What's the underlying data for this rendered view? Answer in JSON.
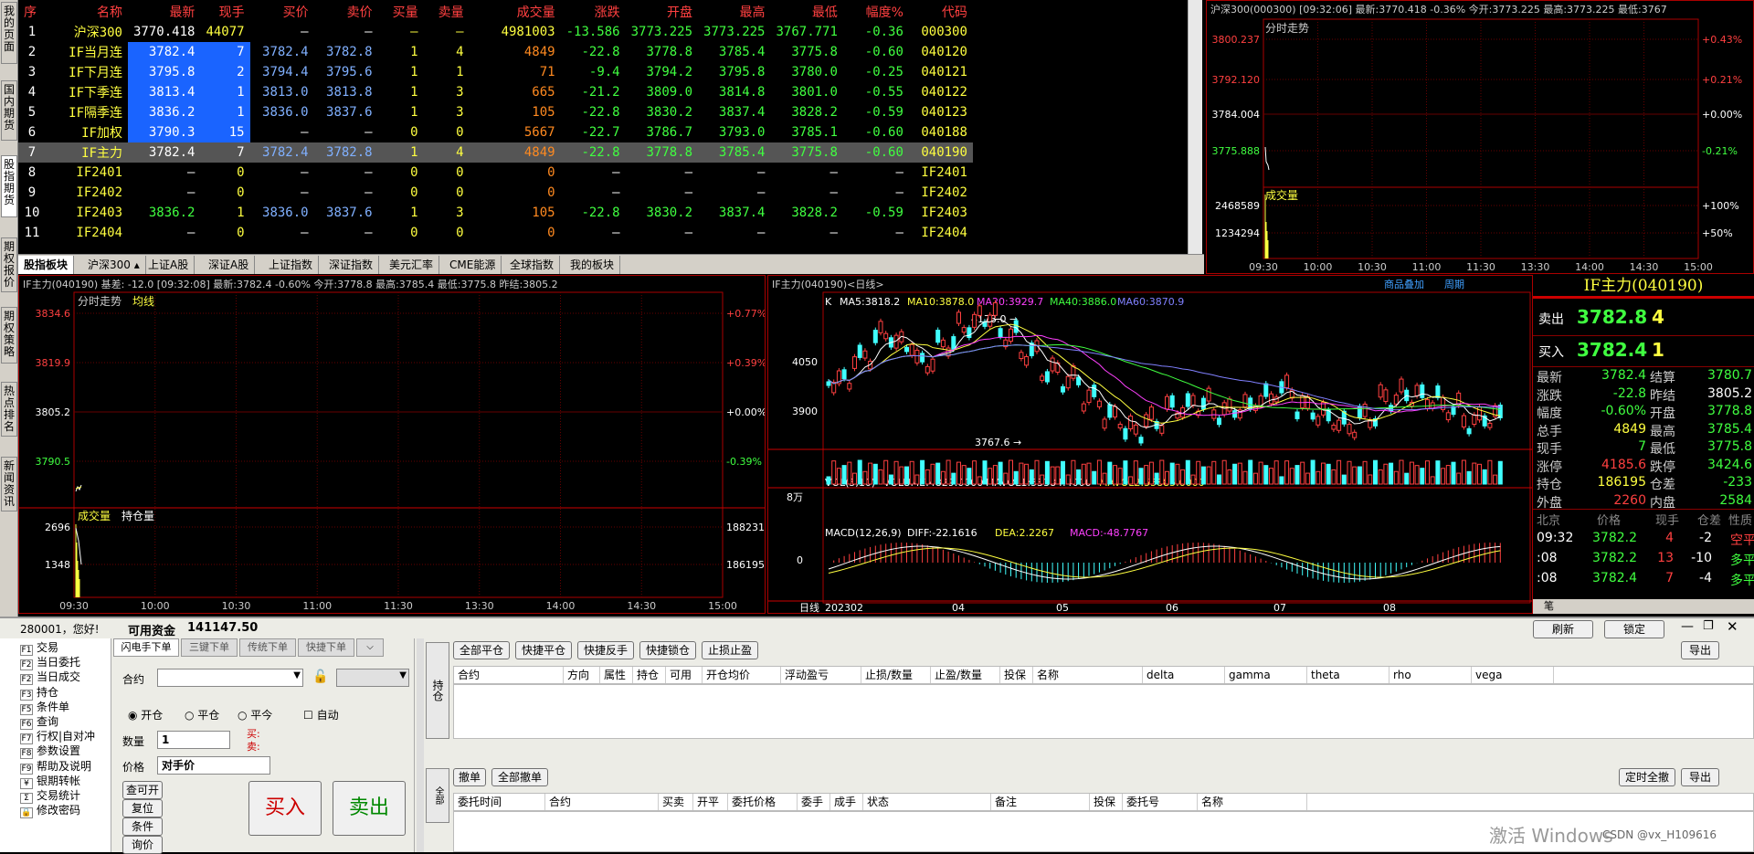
{
  "side_tabs": [
    "我的页面",
    "国内期货",
    "股指期货",
    "期权报价",
    "期权策略",
    "热点排名",
    "新闻资讯"
  ],
  "quote_table": {
    "headers": [
      "序",
      "名称",
      "最新",
      "现手",
      "买价",
      "卖价",
      "买量",
      "卖量",
      "成交量",
      "涨跌",
      "开盘",
      "最高",
      "最低",
      "幅度%",
      "代码"
    ],
    "rows": [
      [
        "1",
        "沪深300",
        "3770.418",
        "44077",
        "—",
        "—",
        "—",
        "—",
        "4981003",
        "-13.586",
        "3773.225",
        "3773.225",
        "3767.771",
        "-0.36",
        "000300"
      ],
      [
        "2",
        "IF当月连",
        "3782.4",
        "7",
        "3782.4",
        "3782.8",
        "1",
        "4",
        "4849",
        "-22.8",
        "3778.8",
        "3785.4",
        "3775.8",
        "-0.60",
        "040120"
      ],
      [
        "3",
        "IF下月连",
        "3795.8",
        "2",
        "3794.4",
        "3795.6",
        "1",
        "1",
        "71",
        "-9.4",
        "3794.2",
        "3795.8",
        "3780.0",
        "-0.25",
        "040121"
      ],
      [
        "4",
        "IF下季连",
        "3813.4",
        "1",
        "3813.0",
        "3813.8",
        "1",
        "3",
        "665",
        "-21.2",
        "3809.0",
        "3814.8",
        "3801.0",
        "-0.55",
        "040122"
      ],
      [
        "5",
        "IF隔季连",
        "3836.2",
        "1",
        "3836.0",
        "3837.6",
        "1",
        "3",
        "105",
        "-22.8",
        "3830.2",
        "3837.4",
        "3828.2",
        "-0.59",
        "040123"
      ],
      [
        "6",
        "IF加权",
        "3790.3",
        "15",
        "—",
        "—",
        "0",
        "0",
        "5667",
        "-22.7",
        "3786.7",
        "3793.0",
        "3785.1",
        "-0.60",
        "040188"
      ],
      [
        "7",
        "IF主力",
        "3782.4",
        "7",
        "3782.4",
        "3782.8",
        "1",
        "4",
        "4849",
        "-22.8",
        "3778.8",
        "3785.4",
        "3775.8",
        "-0.60",
        "040190"
      ],
      [
        "8",
        "IF2401",
        "—",
        "0",
        "—",
        "—",
        "0",
        "0",
        "0",
        "—",
        "—",
        "—",
        "—",
        "—",
        "IF2401"
      ],
      [
        "9",
        "IF2402",
        "—",
        "0",
        "—",
        "—",
        "0",
        "0",
        "0",
        "—",
        "—",
        "—",
        "—",
        "—",
        "IF2402"
      ],
      [
        "10",
        "IF2403",
        "3836.2",
        "1",
        "3836.0",
        "3837.6",
        "1",
        "3",
        "105",
        "-22.8",
        "3830.2",
        "3837.4",
        "3828.2",
        "-0.59",
        "IF2403"
      ],
      [
        "11",
        "IF2404",
        "—",
        "0",
        "—",
        "—",
        "0",
        "0",
        "0",
        "—",
        "—",
        "—",
        "—",
        "—",
        "IF2404"
      ]
    ]
  },
  "bottom_tabs": [
    "股指板块",
    "沪深300 ▴",
    "上证A股",
    "深证A股",
    "上证指数",
    "深证指数",
    "美元汇率",
    "CME能源",
    "全球指数",
    "我的板块"
  ],
  "right_top": {
    "header": "沪深300(000300)  [09:32:06] 最新:3770.418 -0.36% 今开:3773.225 最高:3773.225 最低:3767",
    "title": "分时走势",
    "vol_title": "成交量",
    "prices": [
      "3800.237",
      "3792.120",
      "3784.004",
      "3775.888"
    ],
    "pcts": [
      "+0.43%",
      "+0.21%",
      "+0.00%",
      "-0.21%"
    ],
    "vol_ticks": [
      "2468589",
      "1234294"
    ],
    "vol_pcts": [
      "+100%",
      "+50%"
    ],
    "times": [
      "09:30",
      "10:00",
      "10:30",
      "11:00",
      "11:30",
      "13:30",
      "14:00",
      "14:30",
      "15:00"
    ]
  },
  "left_chart": {
    "header": "IF主力(040190)  基差: -12.0 [09:32:08] 最新:3782.4 -0.60% 今开:3778.8 最高:3785.4 最低:3775.8 昨结:3805.2",
    "title": "分时走势",
    "avg": "均线",
    "vol_title": "成交量",
    "oi_title": "持仓量",
    "prices": [
      "3834.6",
      "3819.9",
      "3805.2",
      "3790.5"
    ],
    "pcts": [
      "+0.77%",
      "+0.39%",
      "+0.00%",
      "-0.39%"
    ],
    "vol_ticks": [
      "2696",
      "1348"
    ],
    "oi_ticks": [
      "188231",
      "186195"
    ],
    "times": [
      "09:30",
      "10:00",
      "10:30",
      "11:00",
      "11:30",
      "13:30",
      "14:00",
      "14:30",
      "15:00"
    ]
  },
  "k_chart": {
    "header": "IF主力(040190)<日线>",
    "link1": "商品叠加",
    "link2": "周期",
    "ma": {
      "label": "K",
      "ma5": "MA5:3818.2",
      "ma10": "MA10:3878.0",
      "ma20": "MA20:3929.7",
      "ma40": "MA40:3886.0",
      "ma60": "MA60:3870.9"
    },
    "high_mark": "4173.0",
    "low_mark": "3767.6",
    "y_ticks": [
      "4050",
      "3900"
    ],
    "vol": {
      "label": "VOL(5,10)",
      "volume": "VOLUME:4829.0000",
      "mavol1": "MAVOL1:53384.4000",
      "mavol2": "MAVOL2:55885.6000",
      "tick": "8万"
    },
    "macd": {
      "label": "MACD(12,26,9)",
      "diff": "DIFF:-22.1616",
      "dea": "DEA:2.2267",
      "macd": "MACD:-48.7767",
      "tick": "0"
    },
    "x_label": "日线",
    "dates": [
      "202302",
      "04",
      "05",
      "06",
      "07",
      "08"
    ]
  },
  "info": {
    "title": "IF主力(040190)",
    "sell_label": "卖出",
    "sell_price": "3782.8",
    "sell_vol": "4",
    "buy_label": "买入",
    "buy_price": "3782.4",
    "buy_vol": "1",
    "rows": [
      [
        "最新",
        "3782.4",
        "结算",
        "3780.7"
      ],
      [
        "涨跌",
        "-22.8",
        "昨结",
        "3805.2"
      ],
      [
        "幅度",
        "-0.60%",
        "开盘",
        "3778.8"
      ],
      [
        "总手",
        "4849",
        "最高",
        "3785.4"
      ],
      [
        "现手",
        "7",
        "最低",
        "3775.8"
      ],
      [
        "涨停",
        "4185.6",
        "跌停",
        "3424.6"
      ],
      [
        "持仓",
        "186195",
        "仓差",
        "-233"
      ],
      [
        "外盘",
        "2260",
        "内盘",
        "2584"
      ]
    ],
    "tick_headers": [
      "北京",
      "价格",
      "现手",
      "仓差",
      "性质"
    ],
    "ticks": [
      [
        "09:32",
        "3782.2",
        "4",
        "-2",
        "空平"
      ],
      [
        ":08",
        "3782.2",
        "13",
        "-10",
        "多平"
      ],
      [
        ":08",
        "3782.4",
        "7",
        "-4",
        "多平"
      ]
    ],
    "footer": "笔"
  },
  "account": {
    "greeting": "280001，您好!",
    "funds_label": "可用资金",
    "funds": "141147.50",
    "refresh": "刷新",
    "lock": "锁定"
  },
  "menu": [
    [
      "F1",
      "交易"
    ],
    [
      "F2",
      "当日委托"
    ],
    [
      "F2",
      "当日成交"
    ],
    [
      "F3",
      "持仓"
    ],
    [
      "F5",
      "条件单"
    ],
    [
      "F6",
      "查询"
    ],
    [
      "F7",
      "行权|自对冲"
    ],
    [
      "F8",
      "参数设置"
    ],
    [
      "F9",
      "帮助及说明"
    ],
    [
      "¥",
      "银期转帐"
    ],
    [
      "Σ",
      "交易统计"
    ],
    [
      "🔒",
      "修改密码"
    ]
  ],
  "order": {
    "tabs": [
      "闪电手下单",
      "三键下单",
      "传统下单",
      "快捷下单"
    ],
    "contract_label": "合约",
    "open": "开仓",
    "close": "平仓",
    "close_today": "平今",
    "auto": "自动",
    "qty_label": "数量",
    "qty": "1",
    "buy_hint": "买:",
    "sell_hint": "卖:",
    "price_label": "价格",
    "price": "对手价",
    "btn_query": "查可开",
    "btn_reset": "复位",
    "btn_cond": "条件",
    "btn_price": "询价",
    "buy": "买入",
    "sell": "卖出"
  },
  "positions": {
    "side_tab": "持仓",
    "side_tab2": "全部",
    "buttons": [
      "全部平仓",
      "快捷平仓",
      "快捷反手",
      "快捷锁仓",
      "止损止盈"
    ],
    "export": "导出",
    "headers": [
      "合约",
      "方向",
      "属性",
      "持仓",
      "可用",
      "开仓均价",
      "浮动盈亏",
      "止损/数量",
      "止盈/数量",
      "投保",
      "名称",
      "delta",
      "gamma",
      "theta",
      "rho",
      "vega"
    ]
  },
  "orders": {
    "buttons": [
      "撤单",
      "全部撤单"
    ],
    "timed": "定时全撤",
    "export": "导出",
    "headers": [
      "委托时间",
      "合约",
      "买卖",
      "开平",
      "委托价格",
      "委手",
      "成手",
      "状态",
      "备注",
      "投保",
      "委托号",
      "名称"
    ]
  },
  "watermark": "激活 Windows",
  "csdn": "CSDN @vx_H109616"
}
